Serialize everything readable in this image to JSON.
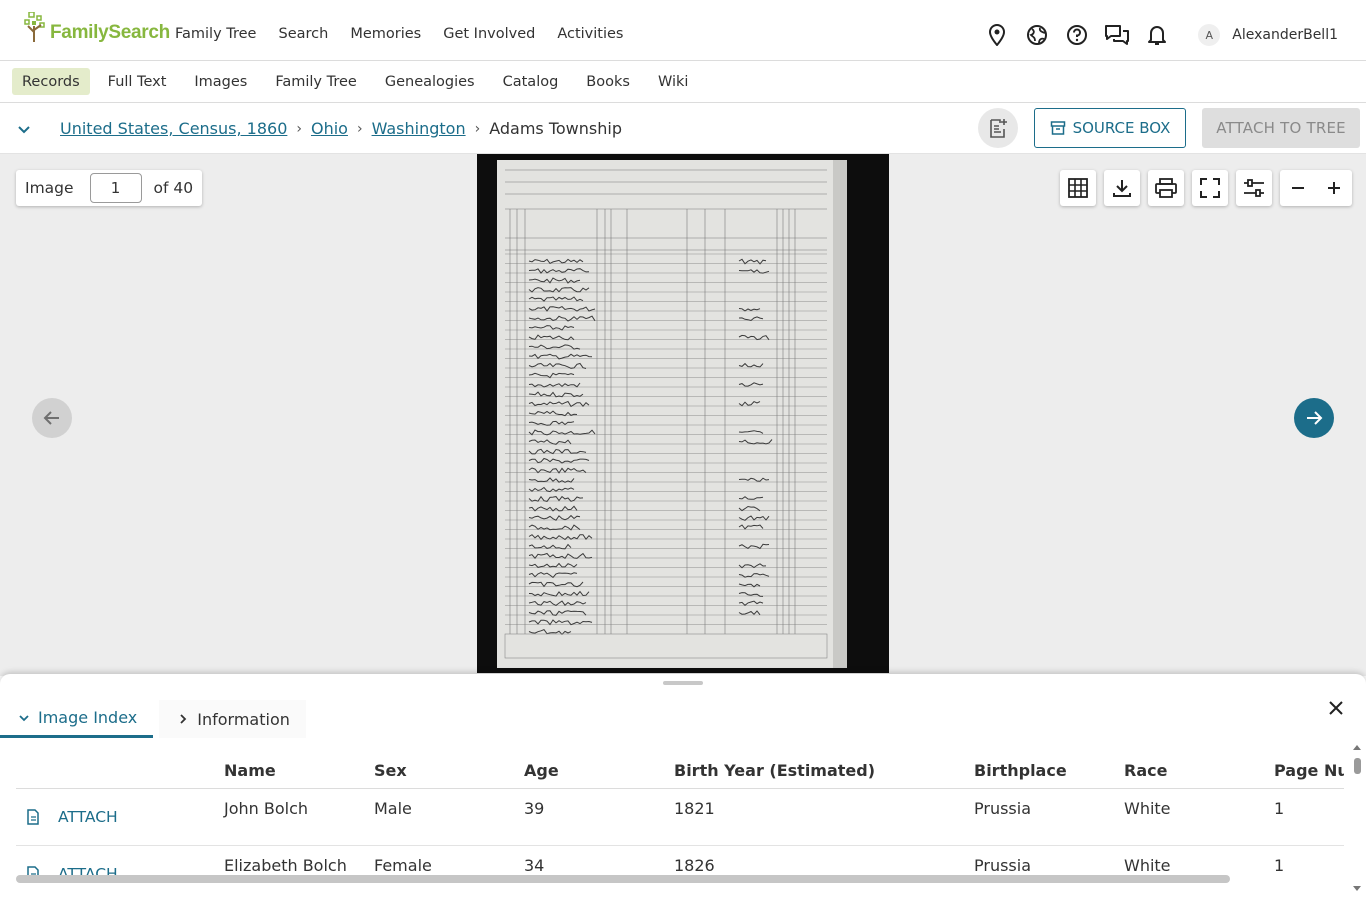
{
  "brand": {
    "name": "FamilySearch",
    "color": "#87b73f"
  },
  "main_nav": [
    "Family Tree",
    "Search",
    "Memories",
    "Get Involved",
    "Activities"
  ],
  "header_icons": [
    "map-pin-icon",
    "globe-icon",
    "help-icon",
    "chat-icon",
    "bell-icon"
  ],
  "user": {
    "initial": "A",
    "name": "AlexanderBell1"
  },
  "sub_nav": {
    "items": [
      "Records",
      "Full Text",
      "Images",
      "Family Tree",
      "Genealogies",
      "Catalog",
      "Books",
      "Wiki"
    ],
    "active": "Records"
  },
  "breadcrumb": {
    "collection": "United States, Census, 1860",
    "state": "Ohio",
    "county": "Washington",
    "current": "Adams Township",
    "separator": "›"
  },
  "actions": {
    "source_box": "SOURCE BOX",
    "attach_to_tree": "ATTACH TO TREE"
  },
  "viewer": {
    "image_label": "Image",
    "image_number": "1",
    "image_total": "of 40",
    "tools": [
      "grid-icon",
      "download-icon",
      "print-icon",
      "fullscreen-icon",
      "adjust-icon",
      "zoom-out-icon",
      "zoom-in-icon"
    ]
  },
  "panel": {
    "tabs": [
      "Image Index",
      "Information"
    ],
    "active_tab": "Image Index",
    "columns": [
      "",
      "Name",
      "Sex",
      "Age",
      "Birth Year (Estimated)",
      "Birthplace",
      "Race",
      "Page Number"
    ],
    "attach_label": "ATTACH",
    "rows": [
      {
        "name": "John Bolch",
        "sex": "Male",
        "age": "39",
        "birth_year": "1821",
        "birthplace": "Prussia",
        "race": "White",
        "page": "1"
      },
      {
        "name": "Elizabeth Bolch",
        "sex": "Female",
        "age": "34",
        "birth_year": "1826",
        "birthplace": "Prussia",
        "race": "White",
        "page": "1"
      }
    ]
  },
  "colors": {
    "accent": "#1c6d8a",
    "active_nav_bg": "#e4eccb",
    "viewer_bg": "#ededed",
    "disabled_btn": "#dedede"
  }
}
